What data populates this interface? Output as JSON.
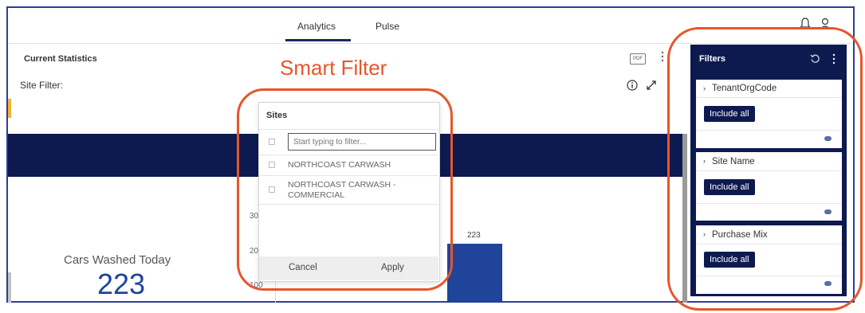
{
  "topbar": {
    "tabs": [
      {
        "label": "Analytics",
        "active": true
      },
      {
        "label": "Pulse",
        "active": false
      }
    ],
    "icons": [
      "bell-icon",
      "user-icon"
    ]
  },
  "dashboard": {
    "panel_title": "Current Statistics",
    "site_filter_label": "Site Filter:",
    "pdf_badge": "PDF"
  },
  "annotation": {
    "smart_filter_label": "Smart Filter",
    "color": "#e7552b"
  },
  "sites_dropdown": {
    "title": "Sites",
    "search_placeholder": "Start typing to filter...",
    "options": [
      {
        "label": "NORTHCOAST CARWASH",
        "checked": false
      },
      {
        "label": "NORTHCOAST CARWASH -",
        "label_line2": "COMMERCIAL",
        "checked": false
      }
    ],
    "cancel_label": "Cancel",
    "apply_label": "Apply"
  },
  "chart_data": {
    "type": "bar",
    "y_tick_labels": [
      "30",
      "20",
      "100"
    ],
    "values": [
      223
    ],
    "data_labels": [
      "223"
    ],
    "color": "#1f449a"
  },
  "kpi": {
    "label": "Cars Washed Today",
    "value": "223"
  },
  "filters_panel": {
    "title": "Filters",
    "cards": [
      {
        "title": "TenantOrgCode",
        "button": "Include all"
      },
      {
        "title": "Site Name",
        "button": "Include all"
      },
      {
        "title": "Purchase Mix",
        "button": "Include all"
      }
    ]
  },
  "colors": {
    "navy": "#0d1a4f",
    "accent_blue": "#1f449a",
    "frame_blue": "#2a3f9d"
  }
}
